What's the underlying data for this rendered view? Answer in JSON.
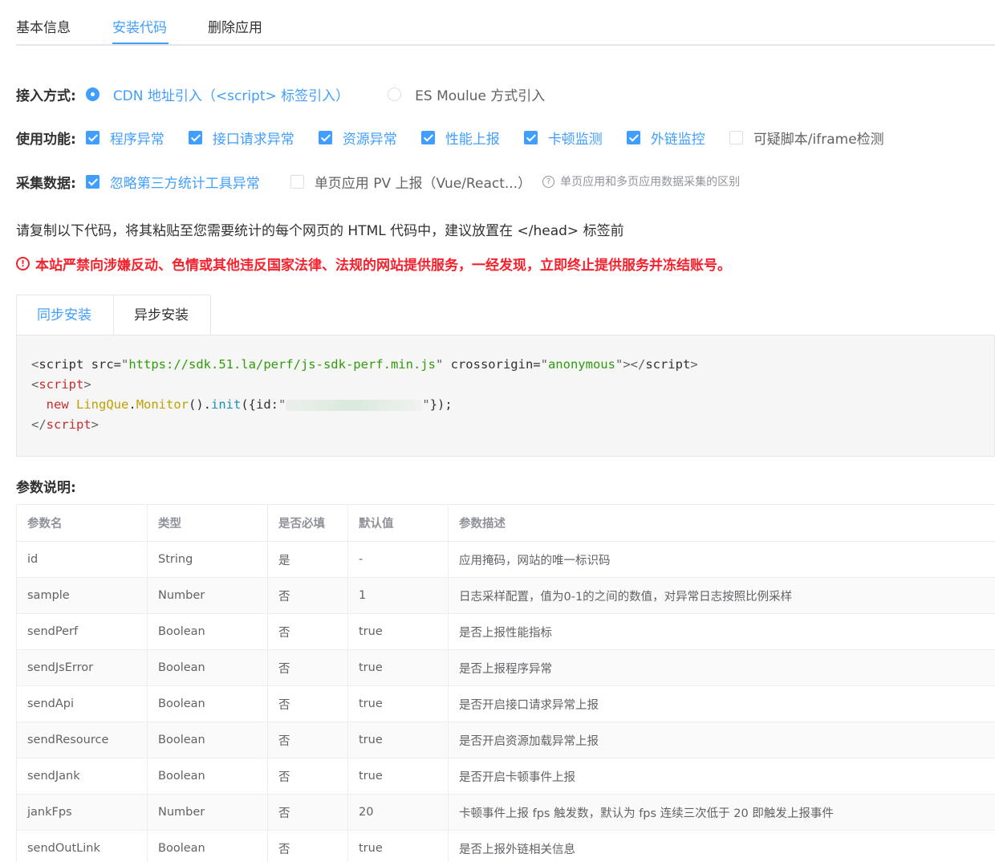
{
  "tabs": [
    "基本信息",
    "安装代码",
    "删除应用"
  ],
  "access": {
    "label": "接入方式:",
    "options": [
      "CDN 地址引入（<script> 标签引入）",
      "ES Moulue 方式引入"
    ]
  },
  "features": {
    "label": "使用功能:",
    "options": [
      "程序异常",
      "接口请求异常",
      "资源异常",
      "性能上报",
      "卡顿监测",
      "外链监控",
      "可疑脚本/iframe检测"
    ]
  },
  "collect": {
    "label": "采集数据:",
    "options": [
      "忽略第三方统计工具异常",
      "单页应用 PV 上报（Vue/React...）"
    ],
    "help": "单页应用和多页应用数据采集的区别"
  },
  "instruction": "请复制以下代码，将其粘贴至您需要统计的每个网页的 HTML 代码中，建议放置在 </head> 标签前",
  "warning": "本站严禁向涉嫌反动、色情或其他违反国家法律、法规的网站提供服务，一经发现，立即终止提供服务并冻结账号。",
  "code_tabs": [
    "同步安装",
    "异步安装"
  ],
  "code": {
    "src_url": "https://sdk.51.la/perf/js-sdk-perf.min.js",
    "crossorigin": "anonymous",
    "masked_id": "••••••••••••••••"
  },
  "params_title": "参数说明:",
  "table": {
    "headers": [
      "参数名",
      "类型",
      "是否必填",
      "默认值",
      "参数描述"
    ],
    "rows": [
      [
        "id",
        "String",
        "是",
        "-",
        "应用掩码，网站的唯一标识码"
      ],
      [
        "sample",
        "Number",
        "否",
        "1",
        "日志采样配置，值为0-1的之间的数值，对异常日志按照比例采样"
      ],
      [
        "sendPerf",
        "Boolean",
        "否",
        "true",
        "是否上报性能指标"
      ],
      [
        "sendJsError",
        "Boolean",
        "否",
        "true",
        "是否上报程序异常"
      ],
      [
        "sendApi",
        "Boolean",
        "否",
        "true",
        "是否开启接口请求异常上报"
      ],
      [
        "sendResource",
        "Boolean",
        "否",
        "true",
        "是否开启资源加载异常上报"
      ],
      [
        "sendJank",
        "Boolean",
        "否",
        "true",
        "是否开启卡顿事件上报"
      ],
      [
        "jankFps",
        "Number",
        "否",
        "20",
        "卡顿事件上报 fps 触发数，默认为 fps 连续三次低于 20 即触发上报事件"
      ],
      [
        "sendOutLink",
        "Boolean",
        "否",
        "true",
        "是否上报外链相关信息"
      ]
    ]
  },
  "colors": {
    "accent": "#409eff",
    "warning": "#f5222d"
  }
}
